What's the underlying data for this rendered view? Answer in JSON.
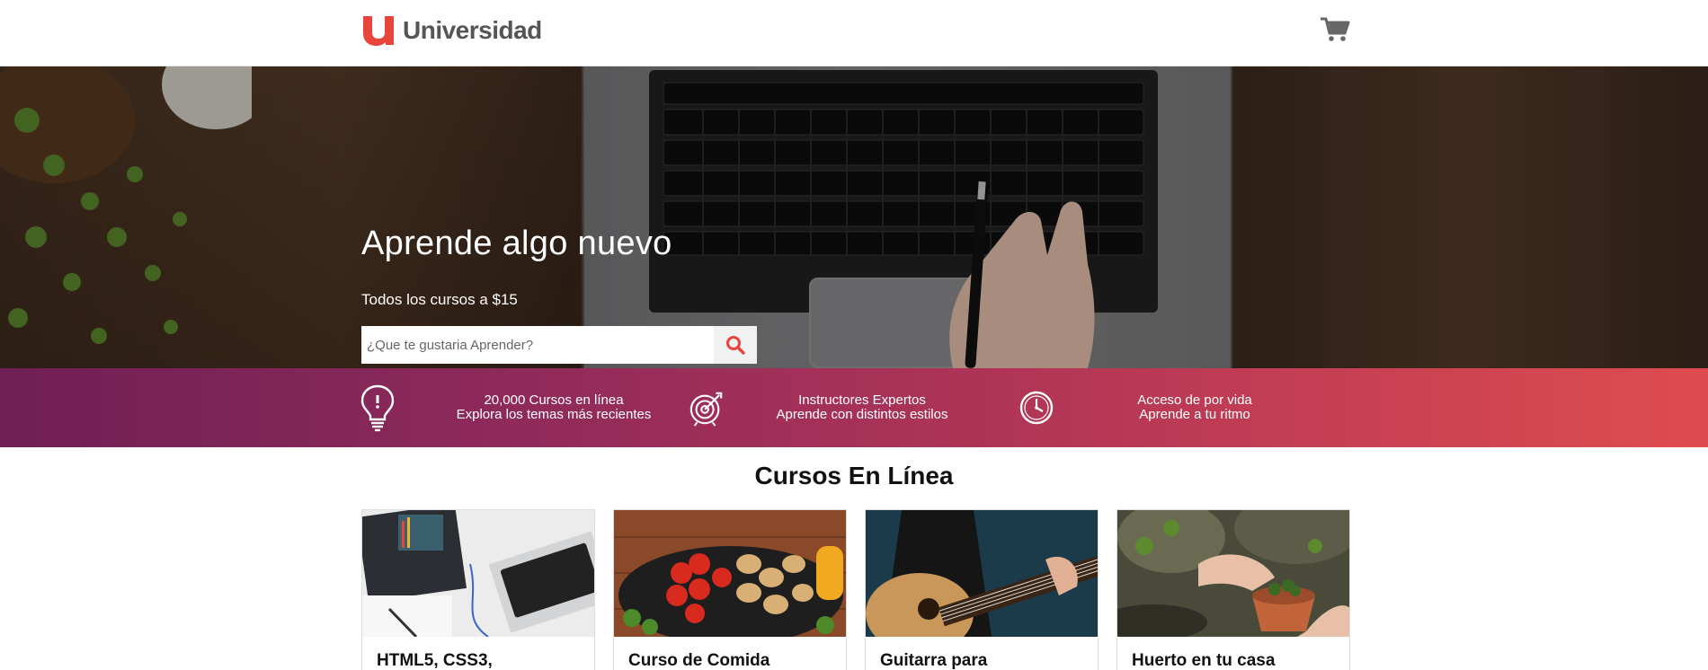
{
  "header": {
    "logo_text": "Universidad",
    "logo_icon": "u-logo-icon",
    "cart_icon": "shopping-cart-icon",
    "brand_color": "#e8453c"
  },
  "hero": {
    "title": "Aprende algo nuevo",
    "subtitle": "Todos los cursos a $15",
    "search": {
      "placeholder": "¿Que te gustaria Aprender?",
      "value": "",
      "icon": "search-icon"
    }
  },
  "features": [
    {
      "icon": "lightbulb-icon",
      "line1": "20,000 Cursos en línea",
      "line2": "Explora los temas más recientes"
    },
    {
      "icon": "target-icon",
      "line1": "Instructores Expertos",
      "line2": "Aprende con distintos estilos"
    },
    {
      "icon": "clock-icon",
      "line1": "Acceso de por vida",
      "line2": "Aprende a tu ritmo"
    }
  ],
  "courses": {
    "title": "Cursos En Línea",
    "items": [
      {
        "name": "HTML5, CSS3,"
      },
      {
        "name": "Curso de Comida"
      },
      {
        "name": "Guitarra para"
      },
      {
        "name": "Huerto en tu casa"
      }
    ]
  },
  "colors": {
    "strip_start": "#6f1f56",
    "strip_end": "#df4c50"
  }
}
